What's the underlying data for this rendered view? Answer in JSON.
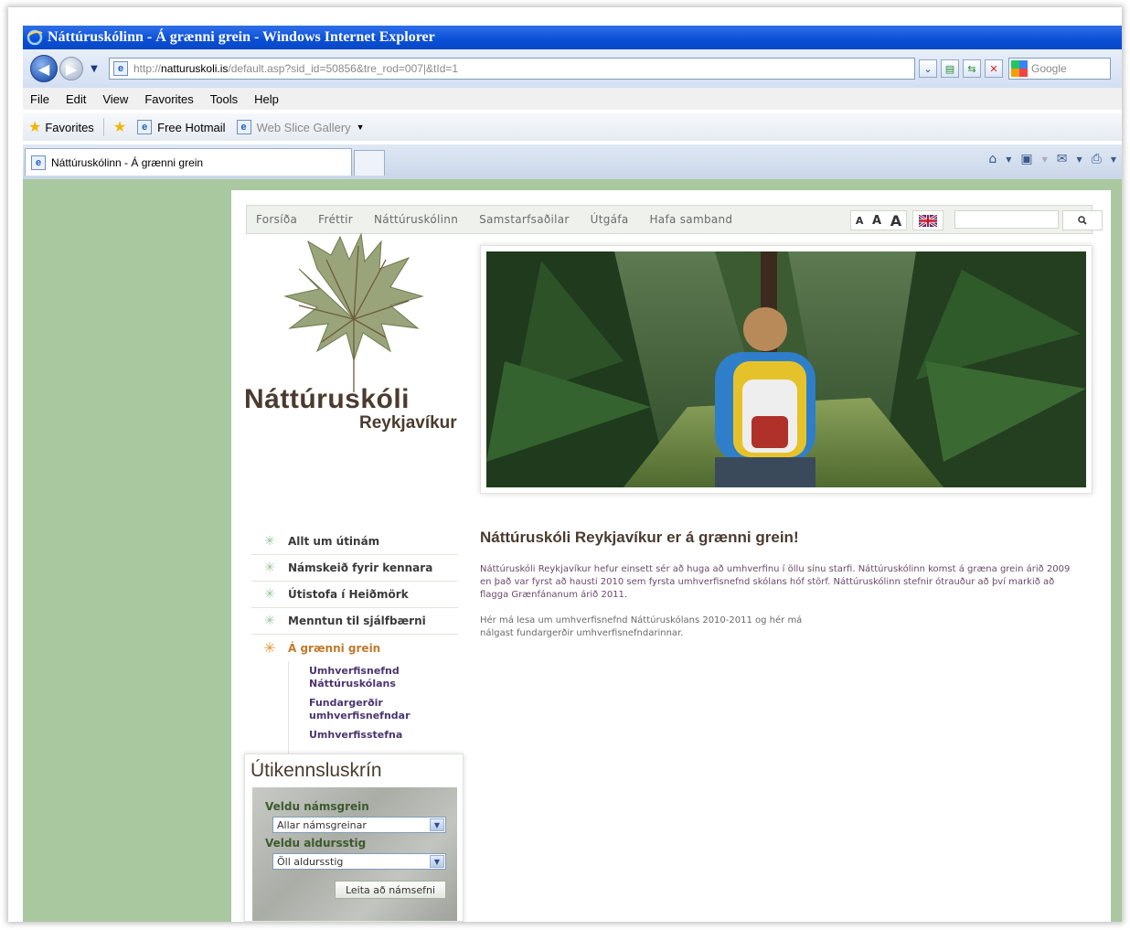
{
  "window": {
    "title": "Náttúruskólinn - Á grænni grein - Windows Internet Explorer"
  },
  "address": {
    "url_prefix": "http://",
    "url_domain": "natturuskoli.is",
    "url_path": "/default.asp?sid_id=50856&tre_rod=007|&tId=1",
    "search_placeholder": "Google"
  },
  "menu": [
    "File",
    "Edit",
    "View",
    "Favorites",
    "Tools",
    "Help"
  ],
  "favorites": {
    "label": "Favorites",
    "links": [
      "Free Hotmail",
      "Web Slice Gallery"
    ]
  },
  "tabs": {
    "active_label": "Náttúruskólinn - Á grænni grein"
  },
  "site": {
    "nav": [
      "Forsíða",
      "Fréttir",
      "Náttúruskólinn",
      "Samstarfsaðilar",
      "Útgáfa",
      "Hafa samband"
    ],
    "font_sizes": [
      "A",
      "A",
      "A"
    ],
    "brand_line1": "Náttúruskóli",
    "brand_line2": "Reykjavíkur",
    "left_nav": [
      {
        "label": "Allt um útinám"
      },
      {
        "label": "Námskeið fyrir kennara"
      },
      {
        "label": "Útistofa í Heiðmörk"
      },
      {
        "label": "Menntun til sjálfbærni"
      },
      {
        "label": "Á grænni grein"
      }
    ],
    "sub_nav": [
      "Umhverfisnefnd Náttúruskólans",
      "Fundargerðir umhverfisnefndar",
      "Umhverfisstefna"
    ],
    "article": {
      "heading": "Náttúruskóli Reykjavíkur er á grænni grein!",
      "para1": "Náttúruskóli Reykjavíkur hefur einsett sér að huga að umhverfinu í öllu sínu starfi.  Náttúruskólinn komst á græna grein árið 2009 en það var fyrst að hausti 2010 sem fyrsta umhverfisnefnd skólans hóf störf. Náttúruskólinn stefnir ótrauður að því markið að flagga Grænfánanum árið 2011.",
      "para2": "Hér má lesa um umhverfisnefnd Náttúruskólans 2010-2011 og hér má nálgast fundargerðir umhverfisnefndarinnar."
    },
    "widget": {
      "title": "Útikennsluskrín",
      "label_subject": "Veldu námsgrein",
      "select_subject": "Allar námsgreinar",
      "label_age": "Veldu aldursstig",
      "select_age": "Öll aldursstig",
      "button": "Leita að námsefni"
    }
  }
}
